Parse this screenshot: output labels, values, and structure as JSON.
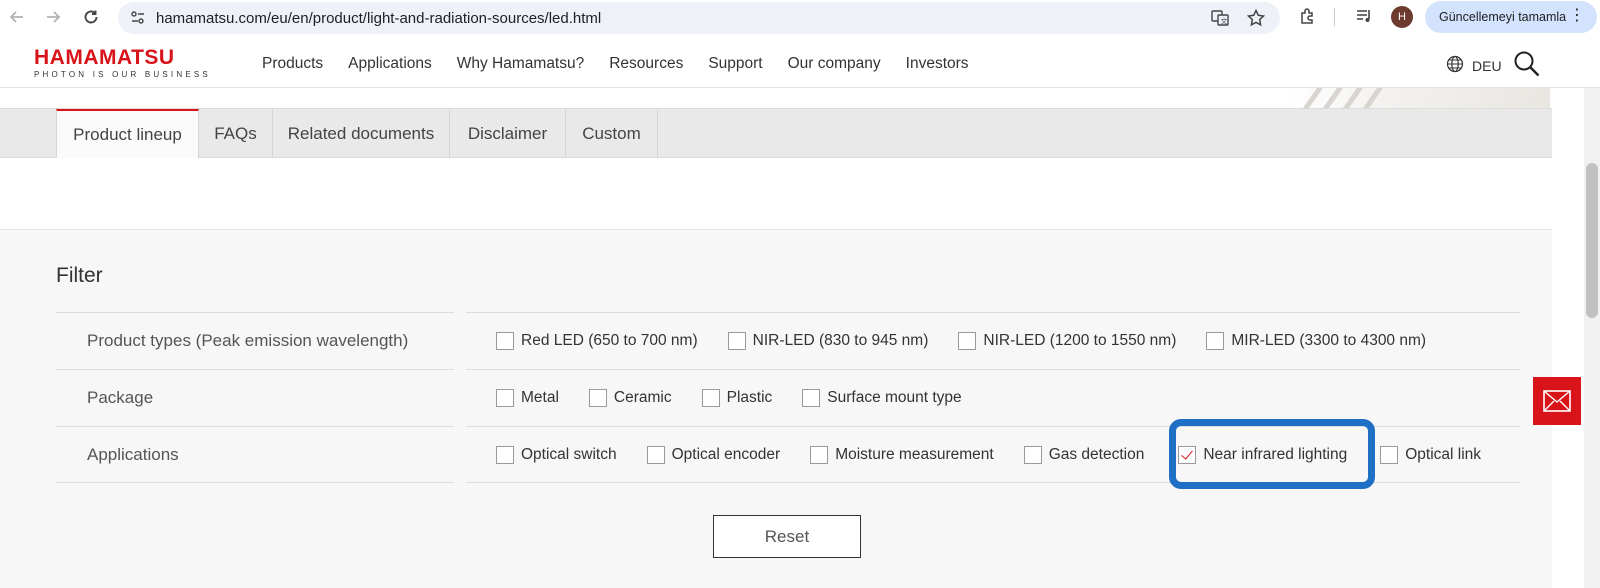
{
  "browser": {
    "url": "hamamatsu.com/eu/en/product/light-and-radiation-sources/led.html",
    "profile_initial": "H",
    "update_label": "Güncellemeyi tamamla"
  },
  "header": {
    "logo_main": "HAMAMATSU",
    "logo_sub": "PHOTON IS OUR BUSINESS",
    "nav": [
      "Products",
      "Applications",
      "Why Hamamatsu?",
      "Resources",
      "Support",
      "Our company",
      "Investors"
    ],
    "language": "DEU"
  },
  "tabs": [
    {
      "label": "Product lineup",
      "active": true
    },
    {
      "label": "FAQs",
      "active": false
    },
    {
      "label": "Related documents",
      "active": false
    },
    {
      "label": "Disclaimer",
      "active": false
    },
    {
      "label": "Custom",
      "active": false
    }
  ],
  "filter": {
    "title": "Filter",
    "rows": [
      {
        "label": "Product types (Peak emission wavelength)",
        "options": [
          {
            "label": "Red LED (650 to 700 nm)",
            "checked": false
          },
          {
            "label": "NIR-LED (830 to 945 nm)",
            "checked": false
          },
          {
            "label": "NIR-LED (1200 to 1550 nm)",
            "checked": false
          },
          {
            "label": "MIR-LED (3300 to 4300 nm)",
            "checked": false
          }
        ]
      },
      {
        "label": "Package",
        "options": [
          {
            "label": "Metal",
            "checked": false
          },
          {
            "label": "Ceramic",
            "checked": false
          },
          {
            "label": "Plastic",
            "checked": false
          },
          {
            "label": "Surface mount type",
            "checked": false
          }
        ]
      },
      {
        "label": "Applications",
        "options": [
          {
            "label": "Optical switch",
            "checked": false
          },
          {
            "label": "Optical encoder",
            "checked": false
          },
          {
            "label": "Moisture measurement",
            "checked": false
          },
          {
            "label": "Gas detection",
            "checked": false
          },
          {
            "label": "Near infrared lighting",
            "checked": true
          },
          {
            "label": "Optical link",
            "checked": false
          }
        ]
      }
    ],
    "reset_label": "Reset"
  },
  "colors": {
    "brand_red": "#d8141a",
    "highlight_blue": "#1f6fc5"
  }
}
